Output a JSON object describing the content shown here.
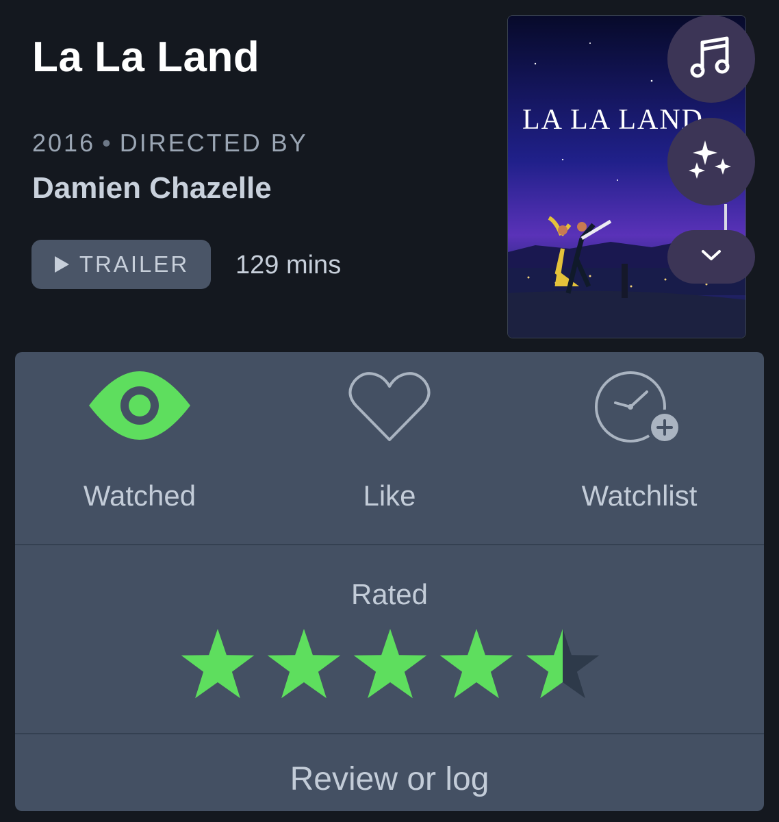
{
  "film": {
    "title": "La La Land",
    "year": "2016",
    "directed_by_label": "DIRECTED BY",
    "director": "Damien Chazelle",
    "trailer_label": "TRAILER",
    "runtime": "129 mins",
    "poster_title": "LA LA LAND"
  },
  "floating_buttons": {
    "music_icon": "music-note-icon",
    "sparkle_icon": "sparkles-icon",
    "more_icon": "chevron-down-icon"
  },
  "actions": {
    "watched": {
      "label": "Watched",
      "icon": "eye-icon",
      "active": true
    },
    "like": {
      "label": "Like",
      "icon": "heart-icon",
      "active": false
    },
    "watchlist": {
      "label": "Watchlist",
      "icon": "clock-plus-icon",
      "active": false
    }
  },
  "rating": {
    "label": "Rated",
    "value": 4.5,
    "max": 5
  },
  "review": {
    "label": "Review or log"
  },
  "colors": {
    "background": "#14181f",
    "sheet": "#445063",
    "accent_green": "#5ede5e",
    "star_empty": "#2e3a4a",
    "fab": "#3c3556"
  }
}
